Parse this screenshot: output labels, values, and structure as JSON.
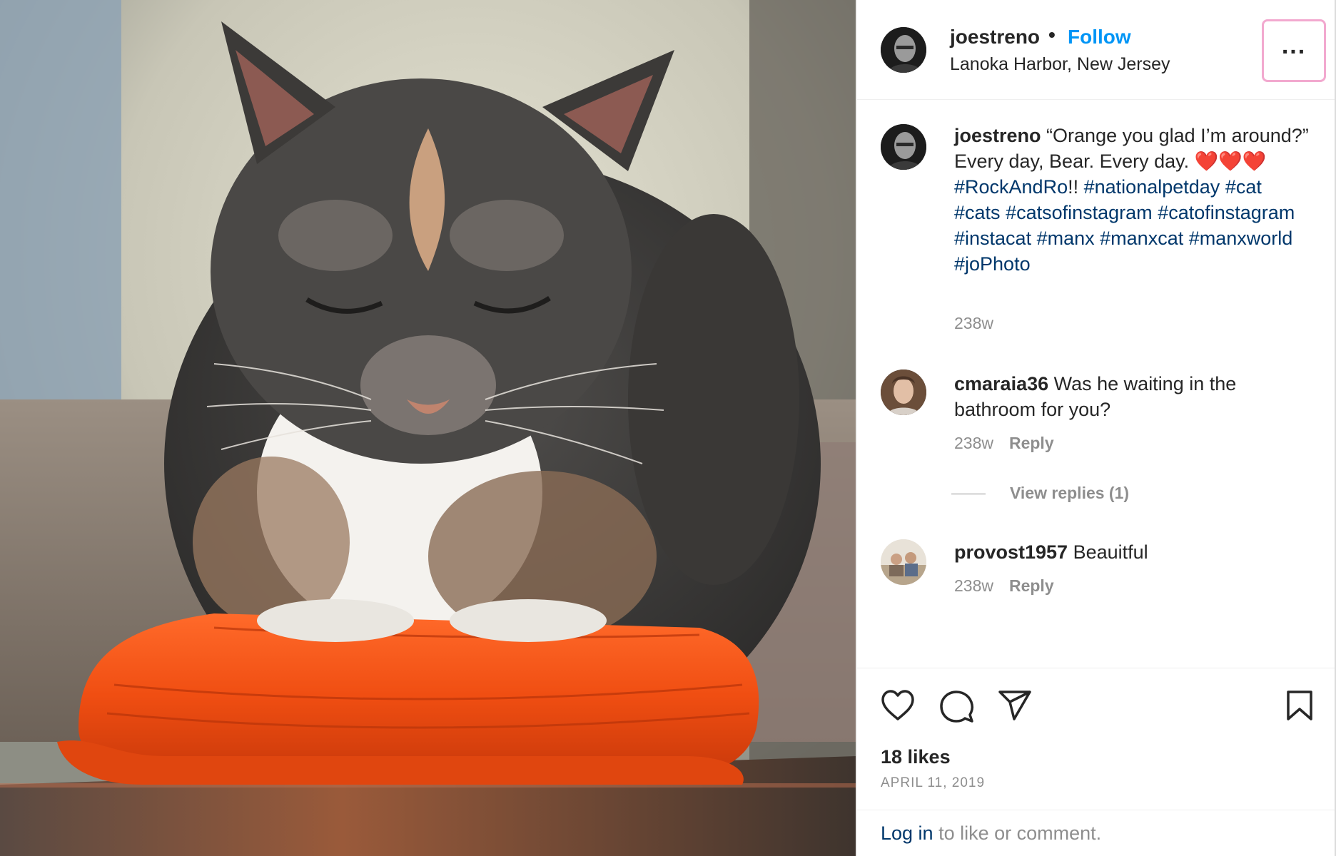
{
  "post": {
    "username": "joestreno",
    "follow_label": "Follow",
    "separator": "•",
    "location": "Lanoka Harbor, New Jersey",
    "more_label": "..."
  },
  "caption": {
    "username": "joestreno",
    "text": "“Orange you glad I’m around?” Every day, Bear. Every day.",
    "hearts": "❤️❤️❤️",
    "tag_first": "#RockAndRo",
    "tag_suffix": "!!",
    "hashtags": [
      "#nationalpetday",
      "#cat",
      "#cats",
      "#catsofinstagram",
      "#catofinstagram",
      "#instacat",
      "#manx",
      "#manxcat",
      "#manxworld",
      "#joPhoto"
    ],
    "time": "238w"
  },
  "comments": [
    {
      "username": "cmaraia36",
      "text": "Was he waiting in the bathroom for you?",
      "time": "238w",
      "reply_label": "Reply",
      "view_replies": "View replies (1)"
    },
    {
      "username": "provost1957",
      "text": "Beauitful",
      "time": "238w",
      "reply_label": "Reply"
    }
  ],
  "actions": {
    "icons": [
      "heart-icon",
      "comment-icon",
      "share-icon",
      "bookmark-icon"
    ],
    "likes": "18 likes",
    "date": "APRIL 11, 2019"
  },
  "login": {
    "link": "Log in",
    "rest": " to like or comment."
  },
  "colors": {
    "accent": "#0095f6",
    "hashtag": "#00376b",
    "muted": "#8e8e8e",
    "text": "#262626",
    "highlight_border": "#f2a9cf"
  }
}
